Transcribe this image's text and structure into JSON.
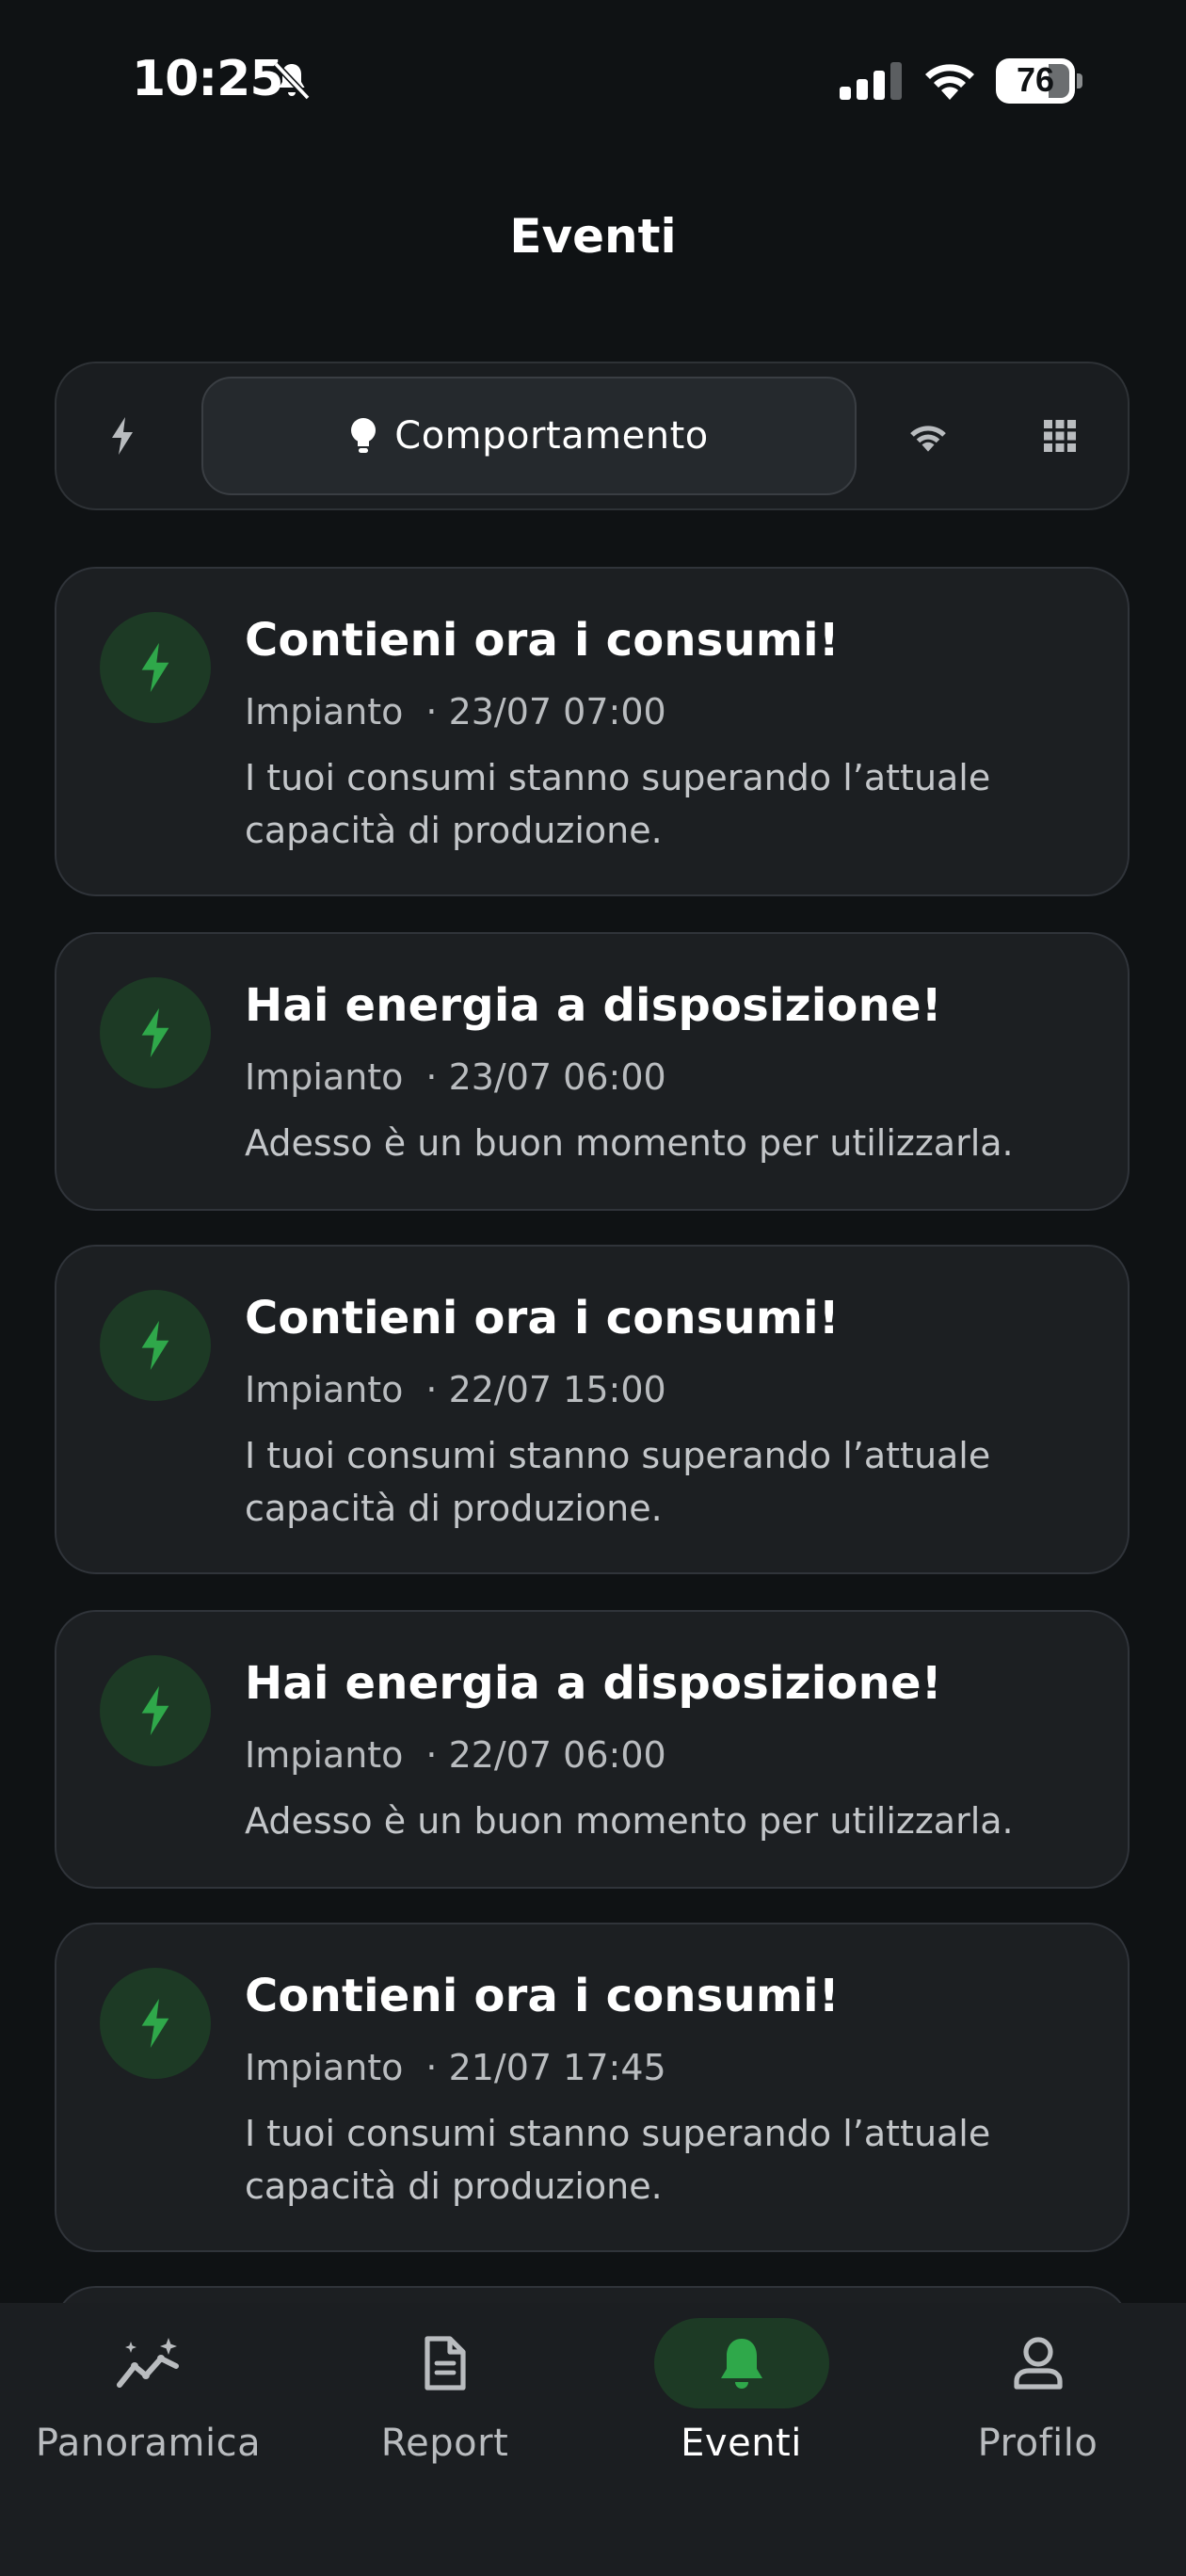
{
  "status_bar": {
    "time": "10:25",
    "battery": "76"
  },
  "header": {
    "title": "Eventi"
  },
  "filters": {
    "selected_label": "Comportamento",
    "icons": [
      "lightning-icon",
      "lightbulb-icon",
      "wifi-icon",
      "grid-icon"
    ]
  },
  "events": [
    {
      "title": "Contieni ora i consumi!",
      "source": "Impianto",
      "datetime": "· 23/07 07:00",
      "description": "I tuoi consumi stanno superando l’attuale capacità di produzione."
    },
    {
      "title": "Hai energia a disposizione!",
      "source": "Impianto",
      "datetime": "· 23/07 06:00",
      "description": "Adesso è un buon momento per utilizzarla."
    },
    {
      "title": "Contieni ora i consumi!",
      "source": "Impianto",
      "datetime": "· 22/07 15:00",
      "description": "I tuoi consumi stanno superando l’attuale capacità di produzione."
    },
    {
      "title": "Hai energia a disposizione!",
      "source": "Impianto",
      "datetime": "· 22/07 06:00",
      "description": "Adesso è un buon momento per utilizzarla."
    },
    {
      "title": "Contieni ora i consumi!",
      "source": "Impianto",
      "datetime": "· 21/07 17:45",
      "description": "I tuoi consumi stanno superando l’attuale capacità di produzione."
    }
  ],
  "bottom_nav": {
    "items": [
      {
        "label": "Panoramica",
        "icon": "chart-sparkle-icon",
        "active": false
      },
      {
        "label": "Report",
        "icon": "document-icon",
        "active": false
      },
      {
        "label": "Eventi",
        "icon": "bell-icon",
        "active": true
      },
      {
        "label": "Profilo",
        "icon": "user-icon",
        "active": false
      }
    ]
  },
  "colors": {
    "background": "#0f1214",
    "card": "#1c1f22",
    "accent_green": "#2fa84a",
    "icon_bg": "#1d3a25"
  }
}
